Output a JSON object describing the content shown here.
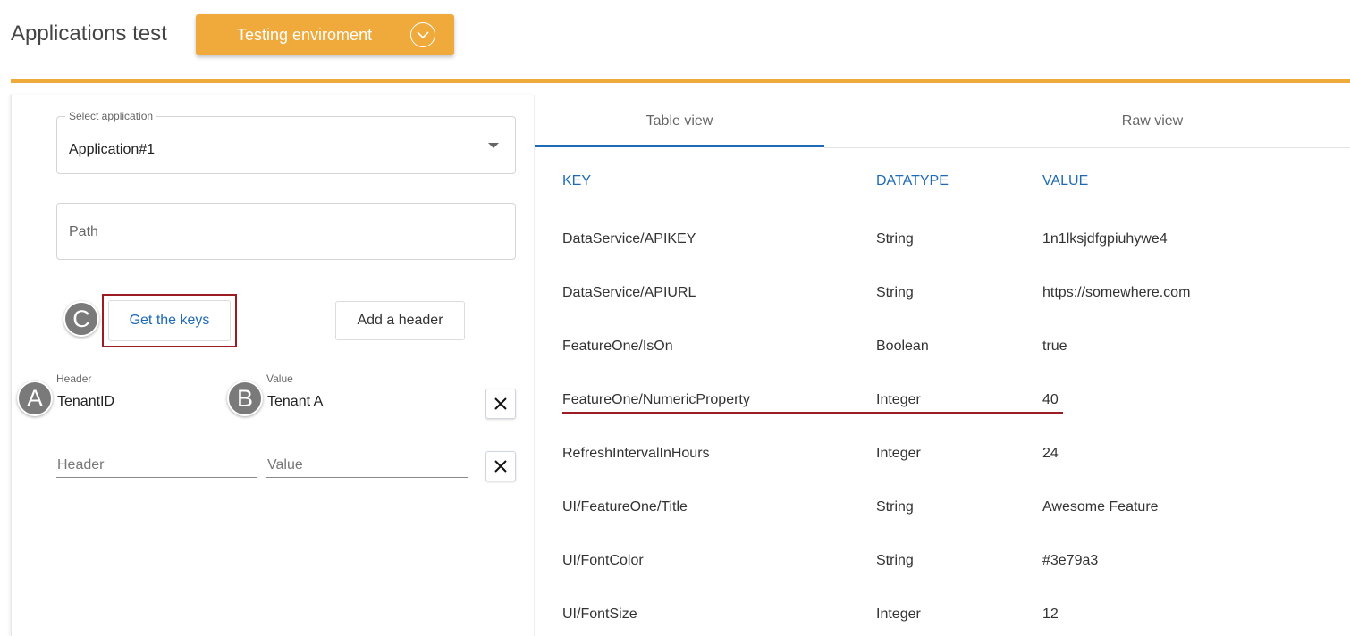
{
  "header": {
    "title": "Applications test",
    "environment_label": "Testing enviroment"
  },
  "form": {
    "select_label": "Select application",
    "select_value": "Application#1",
    "path_placeholder": "Path",
    "get_keys_label": "Get the keys",
    "add_header_label": "Add a header",
    "headers": [
      {
        "header_label": "Header",
        "header_value": "TenantID",
        "value_label": "Value",
        "value_value": "Tenant A"
      },
      {
        "header_placeholder": "Header",
        "value_placeholder": "Value"
      }
    ]
  },
  "markers": {
    "a": "A",
    "b": "B",
    "c": "C"
  },
  "tabs": [
    {
      "label": "Table view",
      "active": true
    },
    {
      "label": "Raw view",
      "active": false
    }
  ],
  "table": {
    "columns": [
      "KEY",
      "DATATYPE",
      "VALUE"
    ],
    "rows": [
      {
        "key": "DataService/APIKEY",
        "datatype": "String",
        "value": "1n1lksjdfgpiuhywe4"
      },
      {
        "key": "DataService/APIURL",
        "datatype": "String",
        "value": "https://somewhere.com"
      },
      {
        "key": "FeatureOne/IsOn",
        "datatype": "Boolean",
        "value": "true"
      },
      {
        "key": "FeatureOne/NumericProperty",
        "datatype": "Integer",
        "value": "40",
        "highlighted": true
      },
      {
        "key": "RefreshIntervalInHours",
        "datatype": "Integer",
        "value": "24"
      },
      {
        "key": "UI/FeatureOne/Title",
        "datatype": "String",
        "value": "Awesome Feature"
      },
      {
        "key": "UI/FontColor",
        "datatype": "String",
        "value": "#3e79a3"
      },
      {
        "key": "UI/FontSize",
        "datatype": "Integer",
        "value": "12"
      }
    ]
  },
  "colors": {
    "accent_orange": "#f0a93b",
    "link_blue": "#1e6ab8",
    "highlight_red": "#9b1c23",
    "marker_gray": "#7a7a7a"
  }
}
